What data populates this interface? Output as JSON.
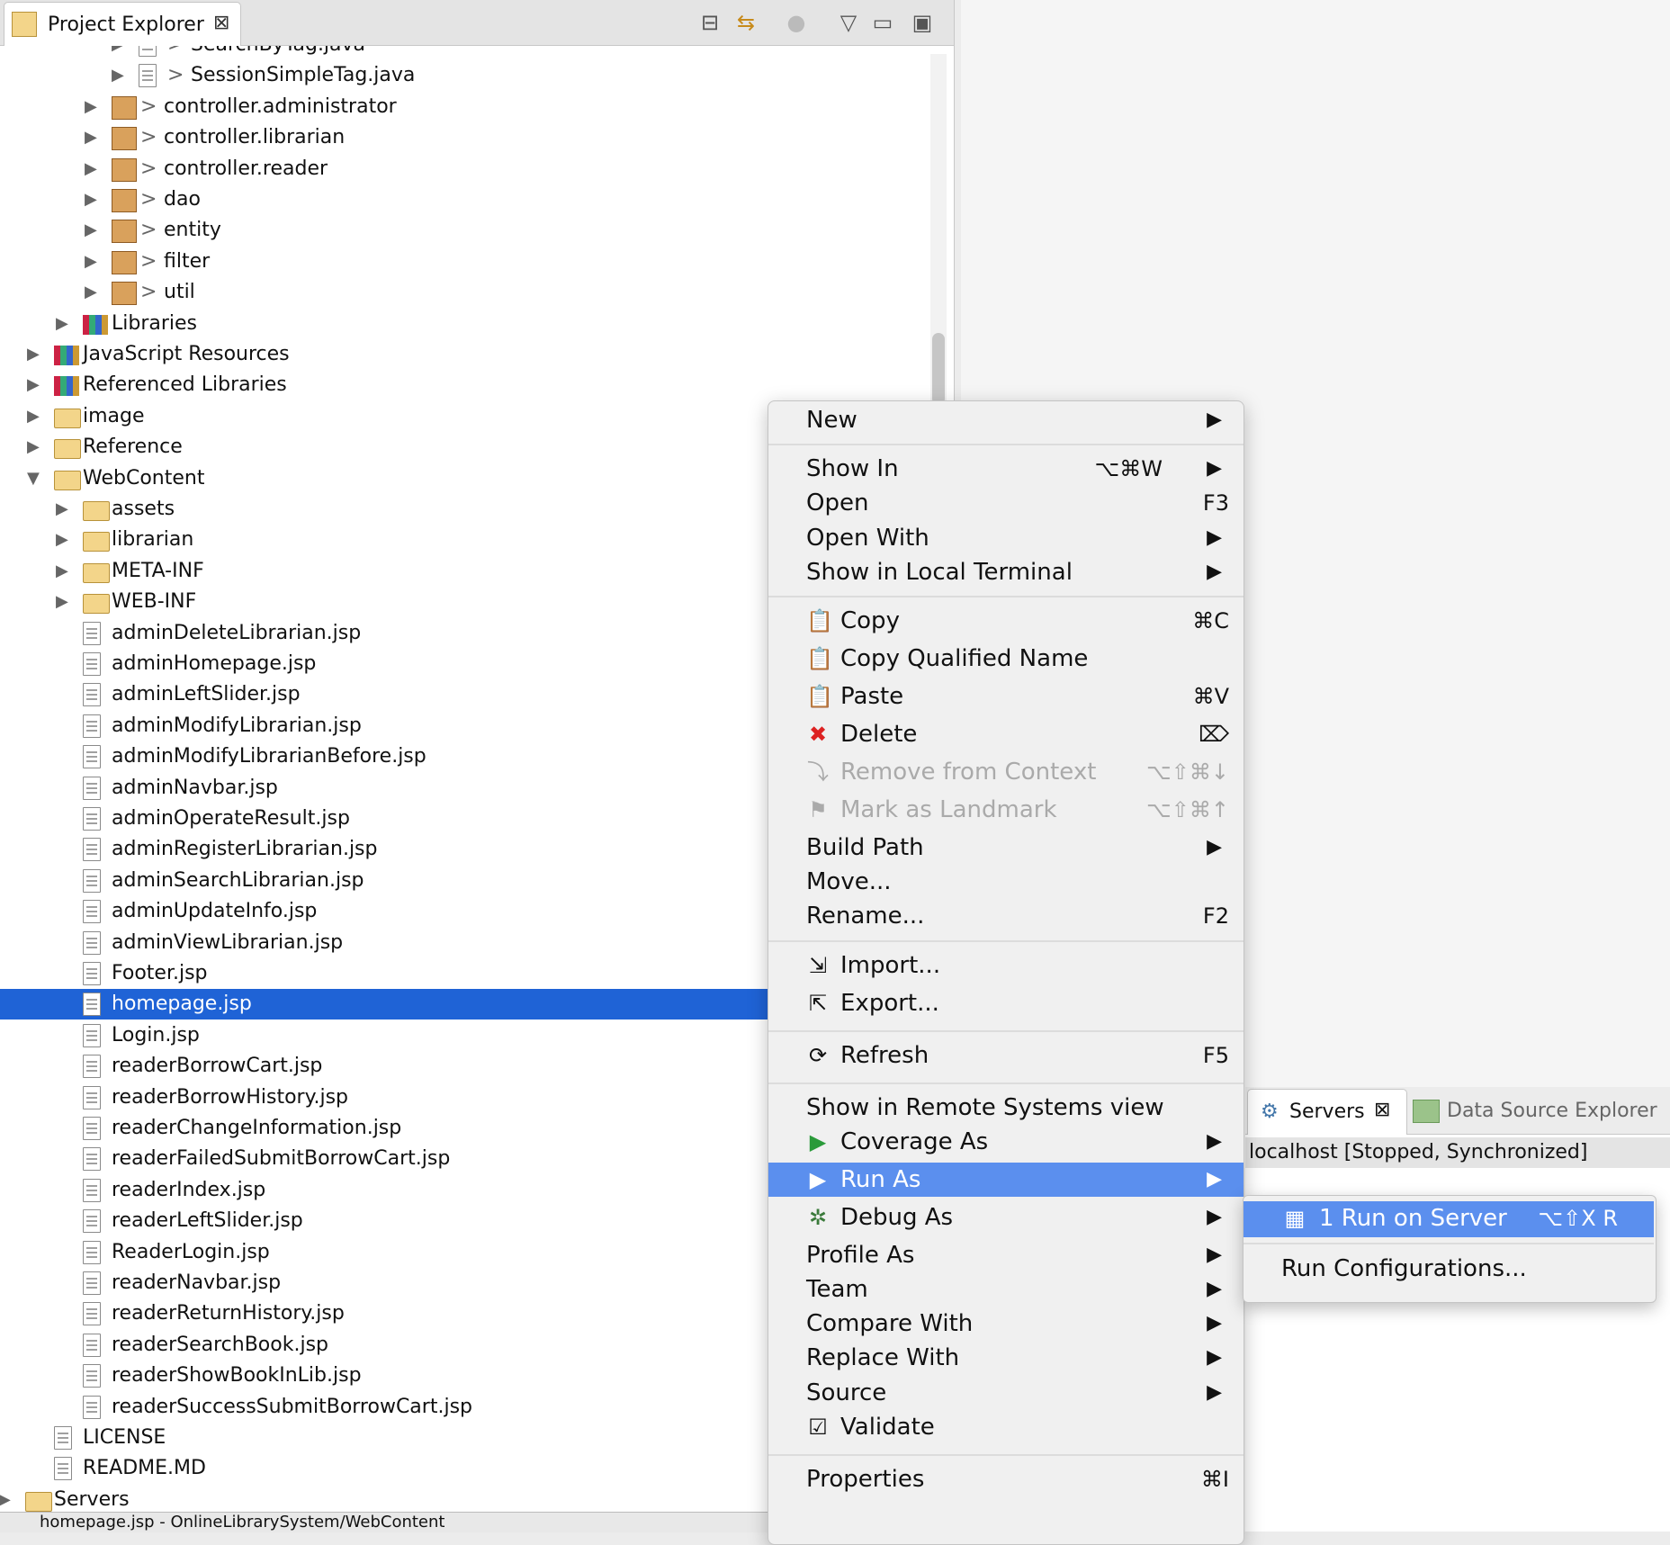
{
  "explorer": {
    "tab_title": "Project Explorer",
    "close_glyph": "⊠",
    "tree": [
      {
        "label": "SearchByTag.java",
        "indent": 150,
        "arrow": "▶",
        "icon": "java",
        "prefix": "> "
      },
      {
        "label": "SessionSimpleTag.java",
        "indent": 150,
        "arrow": "▶",
        "icon": "java",
        "prefix": "> "
      },
      {
        "label": "controller.administrator",
        "indent": 120,
        "arrow": "▶",
        "icon": "pkg",
        "prefix": "> "
      },
      {
        "label": "controller.librarian",
        "indent": 120,
        "arrow": "▶",
        "icon": "pkg",
        "prefix": "> "
      },
      {
        "label": "controller.reader",
        "indent": 120,
        "arrow": "▶",
        "icon": "pkg",
        "prefix": "> "
      },
      {
        "label": "dao",
        "indent": 120,
        "arrow": "▶",
        "icon": "pkg",
        "prefix": "> "
      },
      {
        "label": "entity",
        "indent": 120,
        "arrow": "▶",
        "icon": "pkg",
        "prefix": "> "
      },
      {
        "label": "filter",
        "indent": 120,
        "arrow": "▶",
        "icon": "pkg",
        "prefix": "> "
      },
      {
        "label": "util",
        "indent": 120,
        "arrow": "▶",
        "icon": "pkg",
        "prefix": "> "
      },
      {
        "label": "Libraries",
        "indent": 88,
        "arrow": "▶",
        "icon": "lib",
        "prefix": ""
      },
      {
        "label": "JavaScript Resources",
        "indent": 56,
        "arrow": "▶",
        "icon": "lib",
        "prefix": ""
      },
      {
        "label": "Referenced Libraries",
        "indent": 56,
        "arrow": "▶",
        "icon": "lib",
        "prefix": ""
      },
      {
        "label": "image",
        "indent": 56,
        "arrow": "▶",
        "icon": "folder",
        "prefix": ""
      },
      {
        "label": "Reference",
        "indent": 56,
        "arrow": "▶",
        "icon": "folder",
        "prefix": ""
      },
      {
        "label": "WebContent",
        "indent": 56,
        "arrow": "▼",
        "icon": "folder",
        "prefix": ""
      },
      {
        "label": "assets",
        "indent": 88,
        "arrow": "▶",
        "icon": "folder",
        "prefix": ""
      },
      {
        "label": "librarian",
        "indent": 88,
        "arrow": "▶",
        "icon": "folder",
        "prefix": ""
      },
      {
        "label": "META-INF",
        "indent": 88,
        "arrow": "▶",
        "icon": "folder",
        "prefix": ""
      },
      {
        "label": "WEB-INF",
        "indent": 88,
        "arrow": "▶",
        "icon": "folder",
        "prefix": ""
      },
      {
        "label": "adminDeleteLibrarian.jsp",
        "indent": 88,
        "arrow": "",
        "icon": "file",
        "prefix": ""
      },
      {
        "label": "adminHomepage.jsp",
        "indent": 88,
        "arrow": "",
        "icon": "file",
        "prefix": ""
      },
      {
        "label": "adminLeftSlider.jsp",
        "indent": 88,
        "arrow": "",
        "icon": "file",
        "prefix": ""
      },
      {
        "label": "adminModifyLibrarian.jsp",
        "indent": 88,
        "arrow": "",
        "icon": "file",
        "prefix": ""
      },
      {
        "label": "adminModifyLibrarianBefore.jsp",
        "indent": 88,
        "arrow": "",
        "icon": "file",
        "prefix": ""
      },
      {
        "label": "adminNavbar.jsp",
        "indent": 88,
        "arrow": "",
        "icon": "file",
        "prefix": ""
      },
      {
        "label": "adminOperateResult.jsp",
        "indent": 88,
        "arrow": "",
        "icon": "file",
        "prefix": ""
      },
      {
        "label": "adminRegisterLibrarian.jsp",
        "indent": 88,
        "arrow": "",
        "icon": "file",
        "prefix": ""
      },
      {
        "label": "adminSearchLibrarian.jsp",
        "indent": 88,
        "arrow": "",
        "icon": "file",
        "prefix": ""
      },
      {
        "label": "adminUpdateInfo.jsp",
        "indent": 88,
        "arrow": "",
        "icon": "file",
        "prefix": ""
      },
      {
        "label": "adminViewLibrarian.jsp",
        "indent": 88,
        "arrow": "",
        "icon": "file",
        "prefix": ""
      },
      {
        "label": "Footer.jsp",
        "indent": 88,
        "arrow": "",
        "icon": "file",
        "prefix": ""
      },
      {
        "label": "homepage.jsp",
        "indent": 88,
        "arrow": "",
        "icon": "file",
        "prefix": "",
        "selected": true
      },
      {
        "label": "Login.jsp",
        "indent": 88,
        "arrow": "",
        "icon": "file",
        "prefix": ""
      },
      {
        "label": "readerBorrowCart.jsp",
        "indent": 88,
        "arrow": "",
        "icon": "file",
        "prefix": ""
      },
      {
        "label": "readerBorrowHistory.jsp",
        "indent": 88,
        "arrow": "",
        "icon": "file",
        "prefix": ""
      },
      {
        "label": "readerChangeInformation.jsp",
        "indent": 88,
        "arrow": "",
        "icon": "file",
        "prefix": ""
      },
      {
        "label": "readerFailedSubmitBorrowCart.jsp",
        "indent": 88,
        "arrow": "",
        "icon": "file",
        "prefix": ""
      },
      {
        "label": "readerIndex.jsp",
        "indent": 88,
        "arrow": "",
        "icon": "file",
        "prefix": ""
      },
      {
        "label": "readerLeftSlider.jsp",
        "indent": 88,
        "arrow": "",
        "icon": "file",
        "prefix": ""
      },
      {
        "label": "ReaderLogin.jsp",
        "indent": 88,
        "arrow": "",
        "icon": "file",
        "prefix": ""
      },
      {
        "label": "readerNavbar.jsp",
        "indent": 88,
        "arrow": "",
        "icon": "file",
        "prefix": ""
      },
      {
        "label": "readerReturnHistory.jsp",
        "indent": 88,
        "arrow": "",
        "icon": "file",
        "prefix": ""
      },
      {
        "label": "readerSearchBook.jsp",
        "indent": 88,
        "arrow": "",
        "icon": "file",
        "prefix": ""
      },
      {
        "label": "readerShowBookInLib.jsp",
        "indent": 88,
        "arrow": "",
        "icon": "file",
        "prefix": ""
      },
      {
        "label": "readerSuccessSubmitBorrowCart.jsp",
        "indent": 88,
        "arrow": "",
        "icon": "file",
        "prefix": ""
      },
      {
        "label": "LICENSE",
        "indent": 56,
        "arrow": "",
        "icon": "file",
        "prefix": ""
      },
      {
        "label": "README.MD",
        "indent": 56,
        "arrow": "",
        "icon": "file",
        "prefix": ""
      },
      {
        "label": "Servers",
        "indent": 24,
        "arrow": "▶",
        "icon": "folder",
        "prefix": ""
      }
    ]
  },
  "context_menu": {
    "items": [
      {
        "type": "item",
        "label": "New",
        "submenu": true
      },
      {
        "type": "sep"
      },
      {
        "type": "item",
        "label": "Show In",
        "shortcut": "⌥⌘W",
        "submenu": true
      },
      {
        "type": "item",
        "label": "Open",
        "shortcut": "F3"
      },
      {
        "type": "item",
        "label": "Open With",
        "submenu": true
      },
      {
        "type": "item",
        "label": "Show in Local Terminal",
        "submenu": true
      },
      {
        "type": "sep"
      },
      {
        "type": "item",
        "label": "Copy",
        "shortcut": "⌘C",
        "icon": "copy-icon",
        "glyph": "📋"
      },
      {
        "type": "item",
        "label": "Copy Qualified Name",
        "icon": "copy-qualified-icon",
        "glyph": "📋"
      },
      {
        "type": "item",
        "label": "Paste",
        "shortcut": "⌘V",
        "icon": "paste-icon",
        "glyph": "📋"
      },
      {
        "type": "item",
        "label": "Delete",
        "shortcut": "⌦",
        "icon": "delete-icon",
        "glyph": "✖"
      },
      {
        "type": "item",
        "label": "Remove from Context",
        "shortcut": "⌥⇧⌘↓",
        "icon": "remove-context-icon",
        "glyph": "⤵",
        "disabled": true
      },
      {
        "type": "item",
        "label": "Mark as Landmark",
        "shortcut": "⌥⇧⌘↑",
        "icon": "landmark-icon",
        "glyph": "⚑",
        "disabled": true
      },
      {
        "type": "item",
        "label": "Build Path",
        "submenu": true
      },
      {
        "type": "item",
        "label": "Move..."
      },
      {
        "type": "item",
        "label": "Rename...",
        "shortcut": "F2"
      },
      {
        "type": "sep"
      },
      {
        "type": "item",
        "label": "Import...",
        "icon": "import-icon",
        "glyph": "⇲"
      },
      {
        "type": "item",
        "label": "Export...",
        "icon": "export-icon",
        "glyph": "⇱"
      },
      {
        "type": "sep"
      },
      {
        "type": "item",
        "label": "Refresh",
        "shortcut": "F5",
        "icon": "refresh-icon",
        "glyph": "⟳"
      },
      {
        "type": "sep"
      },
      {
        "type": "item",
        "label": "Show in Remote Systems view"
      },
      {
        "type": "item",
        "label": "Coverage As",
        "submenu": true,
        "icon": "coverage-icon",
        "glyph": "▶"
      },
      {
        "type": "item",
        "label": "Run As",
        "submenu": true,
        "icon": "run-icon",
        "glyph": "▶",
        "active": true
      },
      {
        "type": "item",
        "label": "Debug As",
        "submenu": true,
        "icon": "debug-icon",
        "glyph": "✲"
      },
      {
        "type": "item",
        "label": "Profile As",
        "submenu": true
      },
      {
        "type": "item",
        "label": "Team",
        "submenu": true
      },
      {
        "type": "item",
        "label": "Compare With",
        "submenu": true
      },
      {
        "type": "item",
        "label": "Replace With",
        "submenu": true
      },
      {
        "type": "item",
        "label": "Source",
        "submenu": true
      },
      {
        "type": "item",
        "label": "Validate",
        "icon": "validate-checkbox-icon",
        "glyph": "☑"
      },
      {
        "type": "sep"
      },
      {
        "type": "item",
        "label": "Properties",
        "shortcut": "⌘I"
      }
    ]
  },
  "submenu": {
    "items": [
      {
        "label": "1 Run on Server",
        "shortcut": "⌥⇧X R",
        "active": true
      },
      {
        "label": "Run Configurations..."
      }
    ]
  },
  "servers_panel": {
    "tab_label": "Servers",
    "close_glyph": "⊠",
    "ds_tab_label": "Data Source Explorer",
    "server_row": "localhost  [Stopped, Synchronized]"
  },
  "status_bar": {
    "text": "homepage.jsp - OnlineLibrarySystem/WebContent"
  },
  "colors": {
    "selection": "#1f63d6",
    "menu_active": "#5b8fee",
    "delete_red": "#d22",
    "run_green": "#2a9a3a"
  }
}
